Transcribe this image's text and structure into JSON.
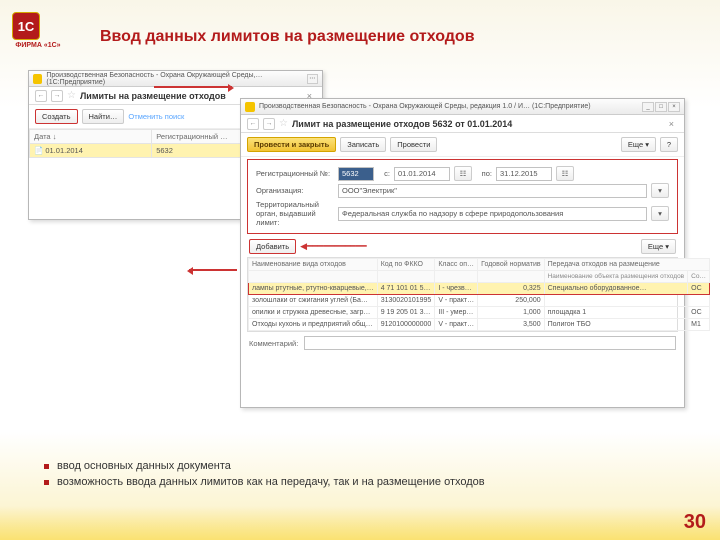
{
  "slide": {
    "title": "Ввод данных лимитов на размещение отходов",
    "page": "30",
    "logo": "1С",
    "firm": "ФИРМА «1С»"
  },
  "win1": {
    "title": "Производственная Безопасность - Охрана Окружающей Среды,… (1С:Предприятие)",
    "doc": "Лимиты на размещение отходов",
    "create": "Создать",
    "find": "Найти…",
    "cancel": "Отменить поиск",
    "col_date": "Дата ↓",
    "col_reg": "Регистрационный …",
    "row_date": "01.01.2014",
    "row_reg": "5632"
  },
  "win2": {
    "title": "Производственная Безопасность - Охрана Окружающей Среды, редакция 1.0 / И… (1С:Предприятие)",
    "doc": "Лимит на размещение отходов 5632 от 01.01.2014",
    "post_close": "Провести и закрыть",
    "write": "Записать",
    "post": "Провести",
    "more": "Еще",
    "q": "?",
    "lbl_reg": "Регистрационный №:",
    "reg": "5632",
    "lbl_from": "с:",
    "from": "01.01.2014",
    "lbl_to": "по:",
    "to": "31.12.2015",
    "lbl_org": "Организация:",
    "org": "ООО\"Электрик\"",
    "lbl_agency": "Территориальный орган, выдавший лимит:",
    "agency": "Федеральная служба по надзору в сфере природопользования",
    "add": "Добавить",
    "th_name": "Наименование вида отходов",
    "th_code": "Код по ФККО",
    "th_class": "Класс оп…",
    "th_norm": "Годовой норматив",
    "th_transfer": "Передача отходов на размещение",
    "th_obj": "Наименование объекта размещения отходов",
    "th_co": "Со…",
    "rows": [
      {
        "name": "лампы ртутные, ртутно-кварцевые,…",
        "code": "4 71 101 01 5…",
        "class": "I - чрезв…",
        "norm": "0,325",
        "obj": "Специально оборудованное…",
        "co": "ОС"
      },
      {
        "name": "золошлаки от сжигания углей (Ба…",
        "code": "3130020101995",
        "class": "V - практ…",
        "norm": "250,000",
        "obj": "",
        "co": ""
      },
      {
        "name": "опилки и стружка древесные, загр…",
        "code": "9 19 205 01 3…",
        "class": "III - умер…",
        "norm": "1,000",
        "obj": "площадка 1",
        "co": "ОС"
      },
      {
        "name": "Отходы кухонь и предприятий общ…",
        "code": "9120100000000",
        "class": "V - практ…",
        "norm": "3,500",
        "obj": "Полигон ТБО",
        "co": "М1"
      }
    ],
    "comment": "Комментарий:"
  },
  "bullets": {
    "b1": "ввод основных данных документа",
    "b2": "возможность ввода данных лимитов как на передачу, так и на размещение отходов"
  }
}
